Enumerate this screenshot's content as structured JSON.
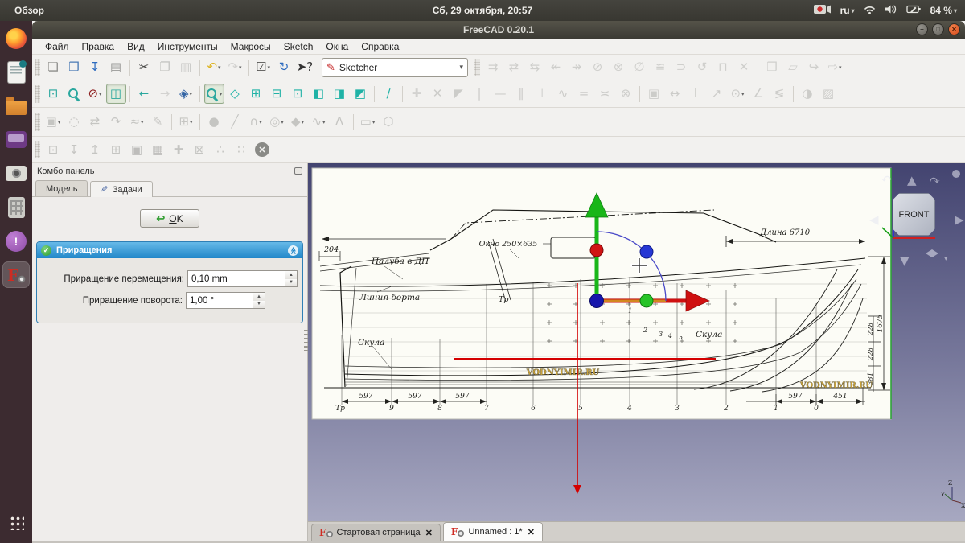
{
  "top_bar": {
    "activities": "Обзор",
    "clock": "Сб, 29 октября, 20:57",
    "keyboard_layout": "ru",
    "battery_percent": "84 %"
  },
  "window": {
    "title": "FreeCAD 0.20.1"
  },
  "menubar": [
    "Файл",
    "Правка",
    "Вид",
    "Инструменты",
    "Макросы",
    "Sketch",
    "Окна",
    "Справка"
  ],
  "workbench_selector": "Sketcher",
  "icons": {
    "dropdown": "▾",
    "ok_arrow": "↩",
    "check": "✓",
    "collapse": "≪",
    "close": "✕",
    "float": "",
    "pen": "✎",
    "minimize": "–",
    "maximize": "□",
    "window_close": "✕"
  },
  "toolbars": {
    "row1a": [
      {
        "n": "new-file",
        "g": "❏",
        "c": "#8f8f8c"
      },
      {
        "n": "open-file",
        "g": "❒",
        "c": "#4a7ab5"
      },
      {
        "n": "save-file",
        "g": "↧",
        "c": "#2d6bbf"
      },
      {
        "n": "print",
        "g": "▤",
        "c": "#9a9a98"
      },
      {
        "sep": 1
      },
      {
        "n": "cut",
        "g": "✂",
        "c": "#4a4a48"
      },
      {
        "n": "copy",
        "g": "❐",
        "c": "#9a9a98",
        "dis": 1
      },
      {
        "n": "paste",
        "g": "▥",
        "c": "#9a9a98",
        "dis": 1
      },
      {
        "sep": 1
      },
      {
        "n": "undo",
        "g": "↶",
        "c": "#ddb31e",
        "dd": 1
      },
      {
        "n": "redo",
        "g": "↷",
        "c": "#b5b5b2",
        "dd": 1,
        "dis": 1
      },
      {
        "sep": 1
      },
      {
        "n": "macro-execute",
        "g": "☑",
        "c": "#3c3c3a",
        "dd": 1
      },
      {
        "n": "refresh",
        "g": "↻",
        "c": "#2d6bbf"
      },
      {
        "n": "whats-this",
        "g": "➤?",
        "c": "#333"
      }
    ],
    "row1b": [
      {
        "n": "constraint-dof",
        "g": "⇉",
        "c": "#aeaeab",
        "dis": 1
      },
      {
        "n": "constraint-chain",
        "g": "⇄",
        "c": "#aeaeab",
        "dis": 1
      },
      {
        "n": "constraint-swap",
        "g": "⇆",
        "c": "#aeaeab",
        "dis": 1
      },
      {
        "n": "select-origin",
        "g": "↞",
        "c": "#aeaeab",
        "dis": 1
      },
      {
        "n": "select-vertical",
        "g": "↠",
        "c": "#aeaeab",
        "dis": 1
      },
      {
        "n": "select-conflicting",
        "g": "⊘",
        "c": "#aeaeab",
        "dis": 1
      },
      {
        "n": "select-redundant",
        "g": "⊗",
        "c": "#aeaeab",
        "dis": 1
      },
      {
        "n": "select-empty",
        "g": "∅",
        "c": "#aeaeab",
        "dis": 1
      },
      {
        "n": "select-associated",
        "g": "≌",
        "c": "#aeaeab",
        "dis": 1
      },
      {
        "n": "select-elements",
        "g": "⊃",
        "c": "#aeaeab",
        "dis": 1
      },
      {
        "n": "restore-state",
        "g": "↺",
        "c": "#aeaeab",
        "dis": 1
      },
      {
        "n": "select-dof",
        "g": "⊓",
        "c": "#aeaeab",
        "dis": 1
      },
      {
        "n": "stop-operation",
        "g": "✕",
        "c": "#aeaeab",
        "dis": 1
      },
      {
        "sep": 1
      },
      {
        "n": "part-box",
        "g": "❒",
        "c": "#aeaeab",
        "dis": 1
      },
      {
        "n": "group-folder",
        "g": "▱",
        "c": "#aeaeab",
        "dis": 1
      },
      {
        "n": "link-make",
        "g": "↪",
        "c": "#aeaeab",
        "dis": 1
      },
      {
        "n": "link-replace",
        "g": "⇨",
        "c": "#aeaeab",
        "dis": 1,
        "dd": 1
      }
    ],
    "row2a": [
      {
        "n": "fit-all",
        "g": "⊡",
        "c": "#2aa79e"
      },
      {
        "n": "fit-selection",
        "cls": "mag",
        "c": "#2aa79e"
      },
      {
        "n": "draw-style",
        "g": "⊘",
        "c": "#8b1a1a",
        "dd": 1
      },
      {
        "n": "selection-bounding-box",
        "g": "◫",
        "c": "#2aa79e",
        "pressed": 1
      },
      {
        "sep": 1
      },
      {
        "n": "nav-back",
        "g": "←",
        "c": "#2aa79e"
      },
      {
        "n": "nav-forward",
        "g": "→",
        "c": "#b5b5b2",
        "dis": 1
      },
      {
        "n": "view-isometric",
        "g": "◈",
        "c": "#3465a4",
        "dd": 1
      },
      {
        "sep": 1
      },
      {
        "n": "zoom-region",
        "cls": "mag",
        "c": "#2aa79e",
        "pressed": 1,
        "dd": 1
      },
      {
        "n": "view-axonometric",
        "g": "◇",
        "c": "#1fb2a6"
      },
      {
        "n": "view-front",
        "g": "⊞",
        "c": "#1fb2a6"
      },
      {
        "n": "view-top",
        "g": "⊟",
        "c": "#1fb2a6"
      },
      {
        "n": "view-right",
        "g": "⊡",
        "c": "#1fb2a6"
      },
      {
        "n": "view-rear",
        "g": "◧",
        "c": "#1fb2a6"
      },
      {
        "n": "view-bottom",
        "g": "◨",
        "c": "#1fb2a6"
      },
      {
        "n": "view-left",
        "g": "◩",
        "c": "#1fb2a6"
      },
      {
        "sep": 1
      },
      {
        "n": "measure-distance",
        "g": "∕",
        "c": "#1fb2a6"
      },
      {
        "sep": 1
      },
      {
        "n": "axis-cross",
        "g": "✚",
        "c": "#b5b5b2",
        "dis": 1
      }
    ],
    "row2b": [
      {
        "n": "constrain-coincident",
        "g": "✕",
        "c": "#a8a8a5",
        "dis": 1
      },
      {
        "n": "constrain-point-on-object",
        "g": "◤",
        "c": "#a8a8a5",
        "dis": 1
      },
      {
        "n": "constrain-vertical",
        "g": "|",
        "c": "#a8a8a5",
        "dis": 1
      },
      {
        "n": "constrain-horizontal",
        "g": "—",
        "c": "#a8a8a5",
        "dis": 1
      },
      {
        "n": "constrain-parallel",
        "g": "∥",
        "c": "#a8a8a5",
        "dis": 1
      },
      {
        "n": "constrain-perpendicular",
        "g": "⊥",
        "c": "#a8a8a5",
        "dis": 1
      },
      {
        "n": "constrain-tangent",
        "g": "∿",
        "c": "#a8a8a5",
        "dis": 1
      },
      {
        "n": "constrain-equal",
        "g": "=",
        "c": "#a8a8a5",
        "dis": 1
      },
      {
        "n": "constrain-symmetric",
        "g": "≍",
        "c": "#a8a8a5",
        "dis": 1
      },
      {
        "n": "constrain-block",
        "g": "⊗",
        "c": "#a8a8a5",
        "dis": 1
      },
      {
        "sep": 1
      },
      {
        "n": "constrain-lock",
        "g": "▣",
        "c": "#a8a8a5",
        "dis": 1
      },
      {
        "n": "constrain-distance-x",
        "g": "↔",
        "c": "#a8a8a5",
        "dis": 1
      },
      {
        "n": "constrain-distance-y",
        "g": "I",
        "c": "#a8a8a5",
        "dis": 1
      },
      {
        "n": "constrain-distance",
        "g": "↗",
        "c": "#a8a8a5",
        "dis": 1
      },
      {
        "n": "constrain-radius",
        "g": "⊙",
        "c": "#a8a8a5",
        "dis": 1,
        "dd": 1
      },
      {
        "n": "constrain-angle",
        "g": "∠",
        "c": "#a8a8a5",
        "dis": 1
      },
      {
        "n": "constrain-snell",
        "g": "≶",
        "c": "#a8a8a5",
        "dis": 1
      },
      {
        "sep": 1
      },
      {
        "n": "toggle-driving-constraint",
        "g": "◑",
        "c": "#a8a8a5",
        "dis": 1
      },
      {
        "n": "toggle-active-constraint",
        "g": "▨",
        "c": "#a8a8a5",
        "dis": 1
      }
    ],
    "row3": [
      {
        "n": "edit-sketch",
        "g": "▣",
        "c": "#9a9a97",
        "dis": 1,
        "dd": 1
      },
      {
        "n": "trim-edge",
        "g": "◌",
        "c": "#9a9a97",
        "dis": 1
      },
      {
        "n": "extend-edge",
        "g": "⇄",
        "c": "#9a9a97",
        "dis": 1
      },
      {
        "n": "split-edge",
        "g": "↷",
        "c": "#9a9a97",
        "dis": 1
      },
      {
        "n": "fillet",
        "g": "≈",
        "c": "#9a9a97",
        "dis": 1,
        "dd": 1
      },
      {
        "n": "sketch-pen-tool",
        "g": "✎",
        "c": "#9a9a97",
        "dis": 1
      },
      {
        "sep": 1
      },
      {
        "n": "external-geometry",
        "g": "⊞",
        "c": "#9a9a97",
        "dis": 1,
        "dd": 1
      },
      {
        "sep": 1
      },
      {
        "n": "create-point",
        "g": "●",
        "c": "#9a9a97",
        "dis": 1
      },
      {
        "n": "create-line",
        "g": "╱",
        "c": "#9a9a97",
        "dis": 1
      },
      {
        "n": "create-arc",
        "g": "∩",
        "c": "#9a9a97",
        "dis": 1,
        "dd": 1
      },
      {
        "n": "create-circle",
        "g": "◎",
        "c": "#9a9a97",
        "dis": 1,
        "dd": 1
      },
      {
        "n": "create-conic",
        "g": "◆",
        "c": "#9a9a97",
        "dis": 1,
        "dd": 1
      },
      {
        "n": "create-bspline",
        "g": "∿",
        "c": "#9a9a97",
        "dis": 1,
        "dd": 1
      },
      {
        "n": "create-polyline",
        "g": "Λ",
        "c": "#9a9a97",
        "dis": 1
      },
      {
        "sep": 1
      },
      {
        "n": "create-rectangle",
        "g": "▭",
        "c": "#9a9a97",
        "dis": 1,
        "dd": 1
      },
      {
        "n": "create-polygon",
        "g": "⬡",
        "c": "#9a9a97",
        "dis": 1
      }
    ],
    "row4": [
      {
        "n": "sketch-view-section",
        "g": "⊡",
        "c": "#9a9a97",
        "dis": 1
      },
      {
        "n": "import-geometry",
        "g": "↧",
        "c": "#9a9a97",
        "dis": 1
      },
      {
        "n": "export-geometry",
        "g": "↥",
        "c": "#9a9a97",
        "dis": 1
      },
      {
        "n": "inspect-sketch",
        "g": "⊞",
        "c": "#9a9a97",
        "dis": 1
      },
      {
        "n": "view-box-dark",
        "g": "▣",
        "c": "#8b8b88",
        "dis": 1
      },
      {
        "n": "view-box-shaded",
        "g": "▦",
        "c": "#8b8b88",
        "dis": 1
      },
      {
        "n": "sketch-axes",
        "g": "✚",
        "c": "#9a9a97",
        "dis": 1
      },
      {
        "n": "validate-sketch",
        "g": "⊠",
        "c": "#9a9a97",
        "dis": 1
      },
      {
        "n": "merge-sketches",
        "g": "∴",
        "c": "#9a9a97",
        "dis": 1
      },
      {
        "n": "mirror-sketch",
        "g": "∷",
        "c": "#9a9a97",
        "dis": 1
      },
      {
        "n": "close-task",
        "cls": "closecirc"
      }
    ]
  },
  "dock_items": [
    {
      "n": "firefox",
      "cls": "ic-firefox"
    },
    {
      "n": "text-editor",
      "cls": "ic-doc"
    },
    {
      "n": "files",
      "cls": "ic-folder"
    },
    {
      "n": "media-app",
      "cls": "ic-media"
    },
    {
      "n": "screenshot-tool",
      "cls": "ic-camera"
    },
    {
      "n": "calculator",
      "cls": "ic-calc"
    },
    {
      "n": "chat-app",
      "cls": "ic-chat"
    },
    {
      "n": "freecad",
      "cls": "fc-mark",
      "active": 1
    }
  ],
  "combo_panel": {
    "title": "Комбо панель",
    "tab_model": "Модель",
    "tab_tasks": "Задачи",
    "ok": "OK",
    "section_title": "Приращения",
    "field1_label": "Приращение перемещения:",
    "field1_value": "0,10 mm",
    "field2_label": "Приращение поворота:",
    "field2_value": "1,00 °"
  },
  "viewport": {
    "navcube_front": "FRONT",
    "axes": {
      "z": "Z",
      "y": "Y",
      "x": "X"
    },
    "drawing": {
      "length": "Длина 6710",
      "window": "Окно 250×635",
      "deck": "Палуба в ДП",
      "sheer": "Линия борта",
      "chine_left": "Скула",
      "chine_right": "Скула",
      "tr_mid": "Тр",
      "dim204": "204",
      "dim1675": "1675",
      "dim228a": "228",
      "dim228b": "228",
      "dim381": "381",
      "d597a": "597",
      "d597b": "597",
      "d597c": "597",
      "d597d": "597",
      "d451": "451",
      "watermark": "VODNYIMIR.RU",
      "stations": [
        "Тр",
        "9",
        "8",
        "7",
        "6",
        "5",
        "4",
        "3",
        "2",
        "1",
        "0"
      ],
      "n1": "1",
      "n2": "2",
      "n3": "3",
      "n4": "4",
      "n5": "5"
    }
  },
  "mdi_tabs": {
    "tab1": "Стартовая страница",
    "tab2": "Unnamed : 1*"
  }
}
